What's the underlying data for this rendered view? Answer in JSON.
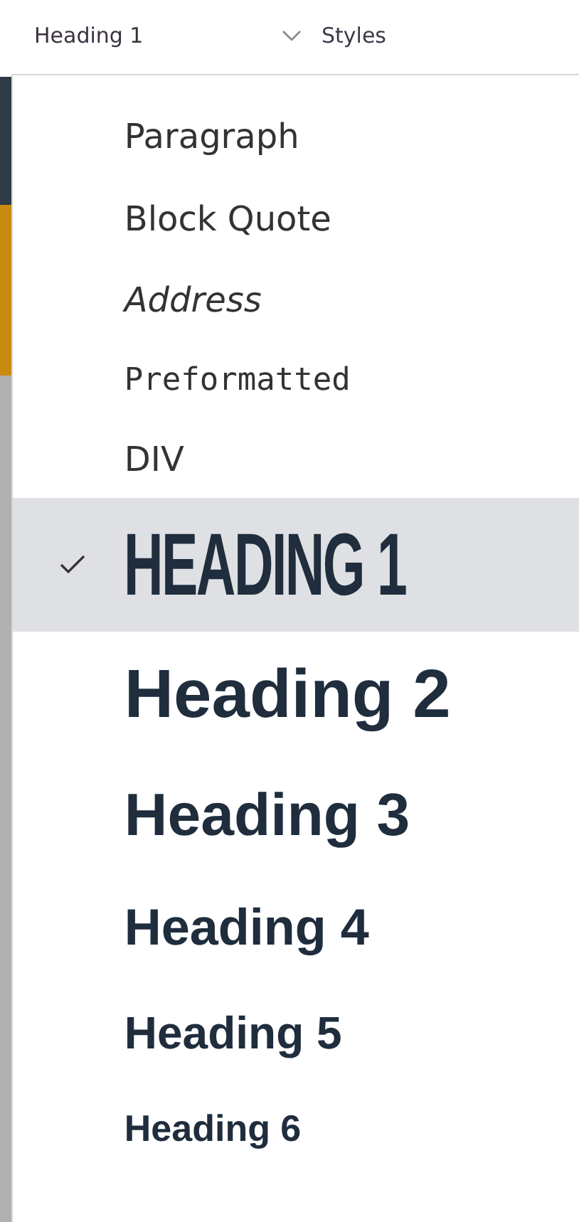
{
  "toolbar": {
    "block_format": "Heading 1",
    "styles": "Styles"
  },
  "menu": {
    "items": [
      {
        "label": "Paragraph",
        "kind": "paragraph",
        "selected": false
      },
      {
        "label": "Block Quote",
        "kind": "blockquote",
        "selected": false
      },
      {
        "label": "Address",
        "kind": "address",
        "selected": false
      },
      {
        "label": "Preformatted",
        "kind": "pre",
        "selected": false
      },
      {
        "label": "DIV",
        "kind": "div",
        "selected": false
      },
      {
        "label": "HEADING 1",
        "kind": "h1",
        "selected": true
      },
      {
        "label": "Heading 2",
        "kind": "h2",
        "selected": false
      },
      {
        "label": "Heading 3",
        "kind": "h3",
        "selected": false
      },
      {
        "label": "Heading 4",
        "kind": "h4",
        "selected": false
      },
      {
        "label": "Heading 5",
        "kind": "h5",
        "selected": false
      },
      {
        "label": "Heading 6",
        "kind": "h6",
        "selected": false
      }
    ]
  }
}
